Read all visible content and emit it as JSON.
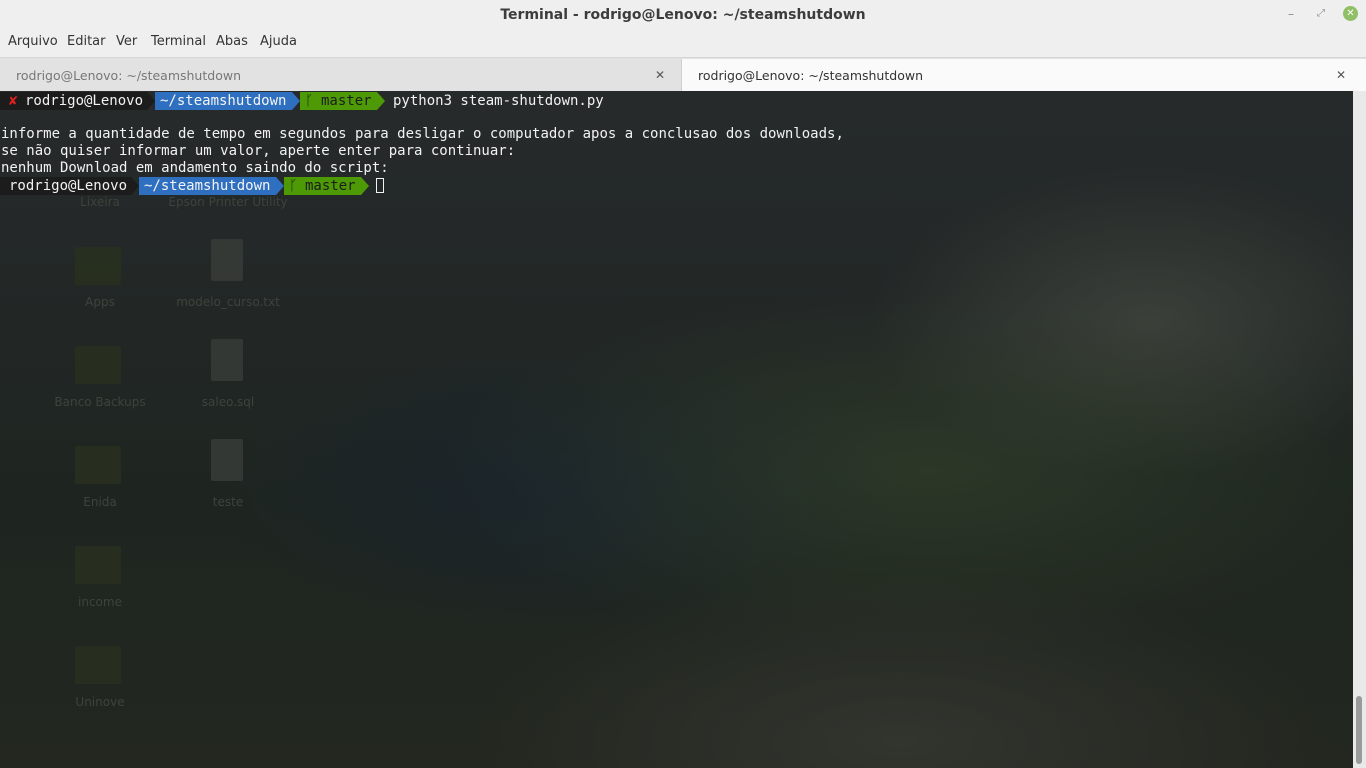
{
  "window": {
    "title": "Terminal - rodrigo@Lenovo: ~/steamshutdown",
    "controls": {
      "minimize": "–",
      "maximize": "⤢",
      "close": "✕"
    }
  },
  "menu": [
    "Arquivo",
    "Editar",
    "Ver",
    "Terminal",
    "Abas",
    "Ajuda"
  ],
  "tabs": [
    {
      "label": "rodrigo@Lenovo: ~/steamshutdown",
      "close": "✕",
      "active": false
    },
    {
      "label": "rodrigo@Lenovo: ~/steamshutdown",
      "close": "✕",
      "active": true
    }
  ],
  "terminal": {
    "prompt1": {
      "status": "✘",
      "user": "rodrigo@Lenovo",
      "dir": "~/steamshutdown",
      "git_icon": "ᚴ",
      "branch": "master",
      "command": "python3 steam-shutdown.py"
    },
    "output": [
      "informe a quantidade de tempo em segundos para desligar o computador apos a conclusao dos downloads,",
      "se não quiser informar um valor, aperte enter para continuar:",
      "nenhum Download em andamento saindo do script:"
    ],
    "prompt2": {
      "user": "rodrigo@Lenovo",
      "dir": "~/steamshutdown",
      "git_icon": "ᚴ",
      "branch": "master"
    }
  },
  "desktop_icons": [
    {
      "label": "Lixeira"
    },
    {
      "label": "Epson Printer Utility"
    },
    {
      "label": "Apps"
    },
    {
      "label": "modelo_curso.txt"
    },
    {
      "label": "Banco Backups"
    },
    {
      "label": "saleo.sql"
    },
    {
      "label": "Enida"
    },
    {
      "label": "teste"
    },
    {
      "label": "income"
    },
    {
      "label": "Uninove"
    }
  ],
  "colors": {
    "prompt_user_bg": "#1c1c1c",
    "prompt_dir_bg": "#2f6fbf",
    "prompt_git_bg": "#4e9a06",
    "status_error": "#e02020"
  }
}
